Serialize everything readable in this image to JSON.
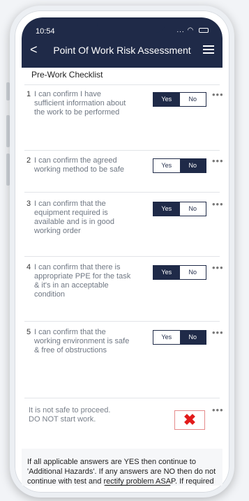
{
  "status": {
    "time": "10:54",
    "right": "..."
  },
  "nav": {
    "title": "Point Of Work Risk Assessment",
    "back": "<"
  },
  "section": {
    "title": "Pre-Work Checklist"
  },
  "questions": [
    {
      "num": "1",
      "text": "I can confirm I have sufficient information about the work to be performed",
      "yes": "Yes",
      "no": "No",
      "selected": "yes"
    },
    {
      "num": "2",
      "text": "I can confirm the agreed working method to be safe",
      "yes": "Yes",
      "no": "No",
      "selected": "no"
    },
    {
      "num": "3",
      "text": "I can confirm that the equipment required is available and is in good working order",
      "yes": "Yes",
      "no": "No",
      "selected": "yes"
    },
    {
      "num": "4",
      "text": "I can confirm that there is appropriate PPE for the task & it's in an acceptable condition",
      "yes": "Yes",
      "no": "No",
      "selected": "yes"
    },
    {
      "num": "5",
      "text": "I can confirm that the working environment is safe & free of obstructions",
      "yes": "Yes",
      "no": "No",
      "selected": "no"
    }
  ],
  "more": "•••",
  "warning": {
    "text": "It is not safe to proceed. DO NOT start work.",
    "icon": "✖"
  },
  "footer": {
    "text": "If all applicable answers are YES then continue to 'Additional Hazards'. If any answers are NO then do not continue with test and rectify problem ASAP. If required consult with Technical Operations for guidance"
  },
  "colors": {
    "navy": "#1f2a48",
    "red": "#e21b1b"
  }
}
